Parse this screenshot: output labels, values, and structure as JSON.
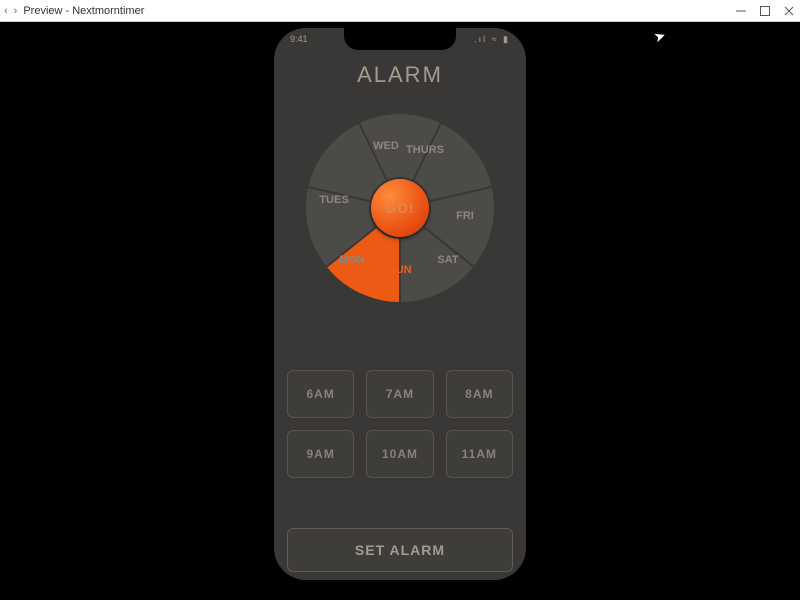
{
  "chrome": {
    "title": "Preview - Nextmorntimer",
    "nav_back": "‹",
    "nav_fwd": "›"
  },
  "statusbar": {
    "time": "9:41",
    "right": ".ıl  ≈  ▮"
  },
  "page": {
    "title": "ALARM",
    "center_label": "GO!",
    "cta_label": "SET ALARM"
  },
  "days": {
    "selected_index": 6,
    "labels": [
      "WED",
      "THURS",
      "FRI",
      "SAT",
      "SUN",
      "MON",
      "TUES"
    ]
  },
  "times": [
    "6AM",
    "7AM",
    "8AM",
    "9AM",
    "10AM",
    "11AM"
  ]
}
